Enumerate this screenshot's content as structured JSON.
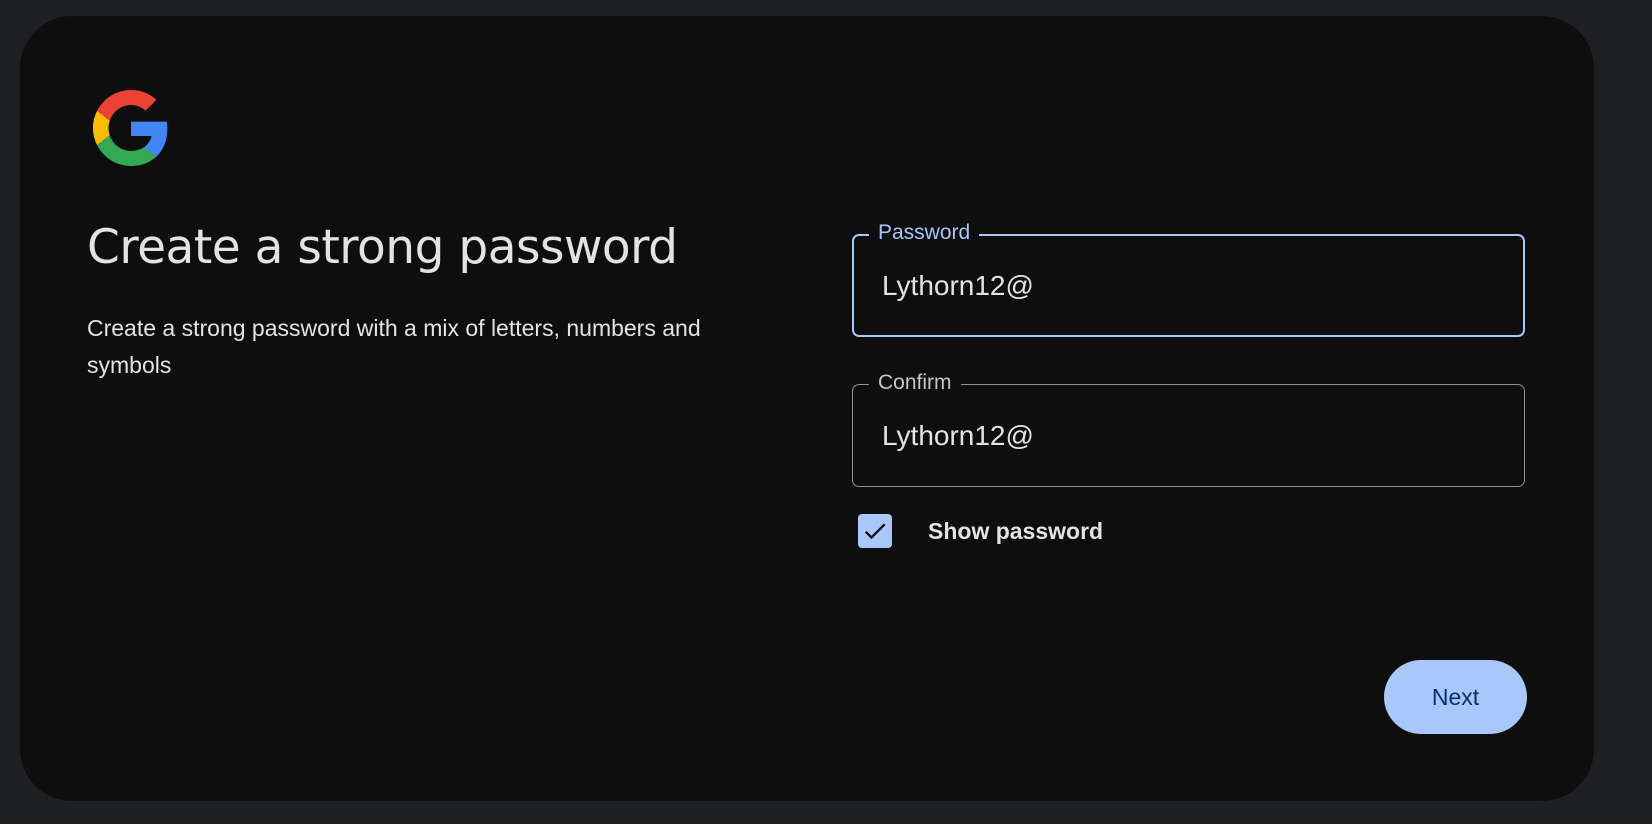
{
  "brand": {
    "logo_icon": "google-g-logo-icon",
    "colors": {
      "blue": "#4285F4",
      "red": "#EA4335",
      "yellow": "#FBBC05",
      "green": "#34A853"
    }
  },
  "heading": {
    "title": "Create a strong password",
    "subtitle": "Create a strong password with a mix of letters, numbers and symbols"
  },
  "form": {
    "password": {
      "label": "Password",
      "value": "Lythorn12@",
      "focused": true
    },
    "confirm": {
      "label": "Confirm",
      "value": "Lythorn12@"
    },
    "show_password": {
      "label": "Show password",
      "checked": true,
      "icon": "checkmark-icon"
    },
    "next_label": "Next"
  },
  "theme": {
    "page_background": "#1f2023",
    "card_background": "#0e0e0e",
    "accent": "#a8c7fa",
    "button_text": "#062e6f",
    "text": "#e3e3e3"
  }
}
